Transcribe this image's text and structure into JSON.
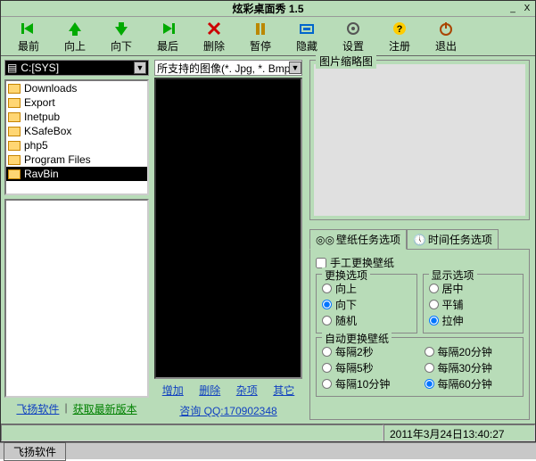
{
  "title": "炫彩桌面秀 1.5",
  "toolbar": {
    "front": "最前",
    "up": "向上",
    "down": "向下",
    "last": "最后",
    "delete": "删除",
    "pause": "暂停",
    "hide": "隐藏",
    "settings": "设置",
    "register": "注册",
    "exit": "退出"
  },
  "drive": "C:[SYS]",
  "folders": [
    "Downloads",
    "Export",
    "Inetpub",
    "KSafeBox",
    "php5",
    "Program Files",
    "RavBin"
  ],
  "left_links": {
    "software": "飞扬软件",
    "latest": "获取最新版本"
  },
  "filter": "所支持的图像(*. Jpg, *. Bmp",
  "mid_btns": {
    "add": "增加",
    "del": "删除",
    "misc": "杂项",
    "other": "其它"
  },
  "qq": "咨询 QQ:170902348",
  "thumb_title": "图片缩略图",
  "tabs": {
    "wallpaper": "壁纸任务选项",
    "time": "时间任务选项"
  },
  "manual": "手工更换壁纸",
  "switch_opts": {
    "title": "更换选项",
    "up": "向上",
    "down": "向下",
    "random": "随机"
  },
  "display_opts": {
    "title": "显示选项",
    "center": "居中",
    "tile": "平铺",
    "stretch": "拉伸"
  },
  "auto": {
    "title": "自动更换壁纸",
    "i2s": "每隔2秒",
    "i5s": "每隔5秒",
    "i10m": "每隔10分钟",
    "i20m": "每隔20分钟",
    "i30m": "每隔30分钟",
    "i60m": "每隔60分钟"
  },
  "status_time": "2011年3月24日13:40:27",
  "taskbar": "飞扬软件"
}
